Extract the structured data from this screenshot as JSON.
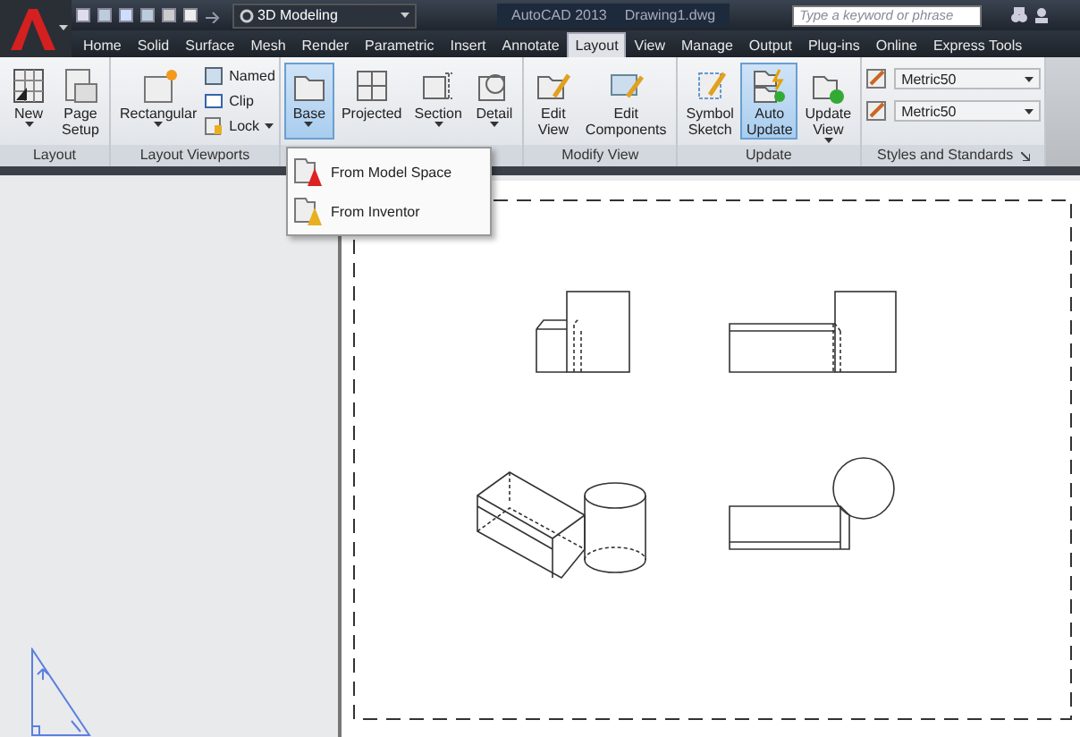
{
  "title_bar": {
    "workspace": "3D Modeling",
    "app_name": "AutoCAD 2013",
    "file_name": "Drawing1.dwg",
    "search": {
      "placeholder": "Type a keyword or phrase"
    }
  },
  "tabs": [
    {
      "label": "Home",
      "selected": false
    },
    {
      "label": "Solid",
      "selected": false
    },
    {
      "label": "Surface",
      "selected": false
    },
    {
      "label": "Mesh",
      "selected": false
    },
    {
      "label": "Render",
      "selected": false
    },
    {
      "label": "Parametric",
      "selected": false
    },
    {
      "label": "Insert",
      "selected": false
    },
    {
      "label": "Annotate",
      "selected": false
    },
    {
      "label": "Layout",
      "selected": true
    },
    {
      "label": "View",
      "selected": false
    },
    {
      "label": "Manage",
      "selected": false
    },
    {
      "label": "Output",
      "selected": false
    },
    {
      "label": "Plug-ins",
      "selected": false
    },
    {
      "label": "Online",
      "selected": false
    },
    {
      "label": "Express Tools",
      "selected": false
    }
  ],
  "ribbon": {
    "panels": [
      {
        "title": "Layout",
        "items": [
          {
            "kind": "large",
            "label": "New",
            "dropdown": true,
            "selected": false
          },
          {
            "kind": "large",
            "label": "Page Setup",
            "dropdown": false,
            "selected": false
          }
        ]
      },
      {
        "title": "Layout Viewports",
        "items": [
          {
            "kind": "large",
            "label": "Rectangular",
            "dropdown": true,
            "selected": false
          },
          {
            "kind": "stack",
            "items": [
              {
                "label": "Named",
                "dropdown": false
              },
              {
                "label": "Clip",
                "dropdown": false
              },
              {
                "label": "Lock",
                "dropdown": true
              }
            ]
          }
        ]
      },
      {
        "items": [
          {
            "kind": "large",
            "label": "Base",
            "dropdown": true,
            "selected": true
          },
          {
            "kind": "large",
            "label": "Projected",
            "dropdown": false,
            "selected": false
          },
          {
            "kind": "large",
            "label": "Section",
            "dropdown": true,
            "selected": false
          },
          {
            "kind": "large",
            "label": "Detail",
            "dropdown": true,
            "selected": false
          }
        ]
      },
      {
        "title": "Modify View",
        "items": [
          {
            "kind": "large",
            "label": "Edit View",
            "dropdown": false,
            "selected": false
          },
          {
            "kind": "large",
            "label": "Edit Components",
            "dropdown": false,
            "selected": false
          }
        ]
      },
      {
        "title": "Update",
        "items": [
          {
            "kind": "large",
            "label": "Symbol Sketch",
            "dropdown": false,
            "selected": false
          },
          {
            "kind": "large",
            "label": "Auto Update",
            "dropdown": false,
            "selected": true
          },
          {
            "kind": "large",
            "label": "Update View",
            "dropdown": true,
            "selected": false
          }
        ]
      },
      {
        "title": "Styles and Standards",
        "items": [
          {
            "kind": "combo",
            "value": "Metric50"
          },
          {
            "kind": "combo",
            "value": "Metric50"
          }
        ]
      }
    ]
  },
  "base_menu": {
    "items": [
      {
        "label": "From Model Space"
      },
      {
        "label": "From Inventor"
      }
    ]
  }
}
